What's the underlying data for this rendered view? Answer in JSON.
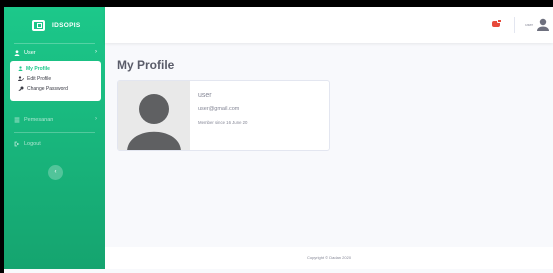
{
  "brand": {
    "name": "IDSOPIS",
    "icon": "laptop-icon"
  },
  "sidebar": {
    "section_user": {
      "label": "User",
      "icon": "user-icon"
    },
    "submenu": [
      {
        "label": "My Profile",
        "icon": "user-icon",
        "active": true
      },
      {
        "label": "Edit Profile",
        "icon": "user-edit-icon",
        "active": false
      },
      {
        "label": "Change Password",
        "icon": "key-icon",
        "active": false
      }
    ],
    "section_pemesanan": {
      "label": "Pemesanan",
      "icon": "list-icon"
    },
    "logout": {
      "label": "Logout",
      "icon": "sign-out-icon"
    },
    "toggle_icon": "chevron-left-icon"
  },
  "topbar": {
    "alert_icon": "bell-icon",
    "user_name": "user",
    "avatar_icon": "user-avatar-icon"
  },
  "main": {
    "title": "My Profile",
    "profile": {
      "name": "user",
      "email": "user@gmail.com",
      "member_since": "Member since 16 June 20"
    }
  },
  "footer": {
    "text": "Copyright © Dadan 2020"
  },
  "colors": {
    "sidebar": "#1cc88a",
    "background": "#f8f9fc",
    "alert": "#e74a3b"
  }
}
